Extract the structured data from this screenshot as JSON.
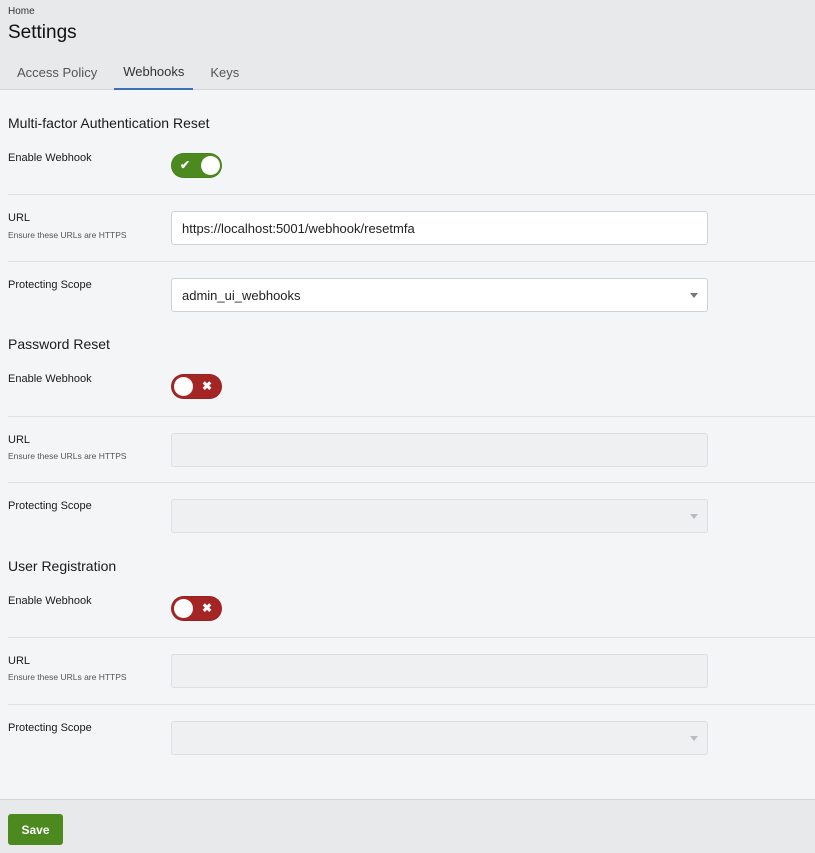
{
  "breadcrumb": "Home",
  "page_title": "Settings",
  "tabs": [
    {
      "label": "Access Policy",
      "active": false
    },
    {
      "label": "Webhooks",
      "active": true
    },
    {
      "label": "Keys",
      "active": false
    }
  ],
  "sections": [
    {
      "title": "Multi-factor Authentication Reset",
      "enable_label": "Enable Webhook",
      "enabled": true,
      "toggle_mark": "✔",
      "url_label": "URL",
      "url_help": "Ensure these URLs are HTTPS",
      "url_value": "https://localhost:5001/webhook/resetmfa",
      "scope_label": "Protecting Scope",
      "scope_value": "admin_ui_webhooks"
    },
    {
      "title": "Password Reset",
      "enable_label": "Enable Webhook",
      "enabled": false,
      "toggle_mark": "✖",
      "url_label": "URL",
      "url_help": "Ensure these URLs are HTTPS",
      "url_value": "",
      "scope_label": "Protecting Scope",
      "scope_value": ""
    },
    {
      "title": "User Registration",
      "enable_label": "Enable Webhook",
      "enabled": false,
      "toggle_mark": "✖",
      "url_label": "URL",
      "url_help": "Ensure these URLs are HTTPS",
      "url_value": "",
      "scope_label": "Protecting Scope",
      "scope_value": ""
    }
  ],
  "colors": {
    "accent_green": "#4c8a1f",
    "toggle_off_red": "#a52525",
    "tab_underline": "#3b6fb6"
  },
  "footer": {
    "save_label": "Save"
  }
}
